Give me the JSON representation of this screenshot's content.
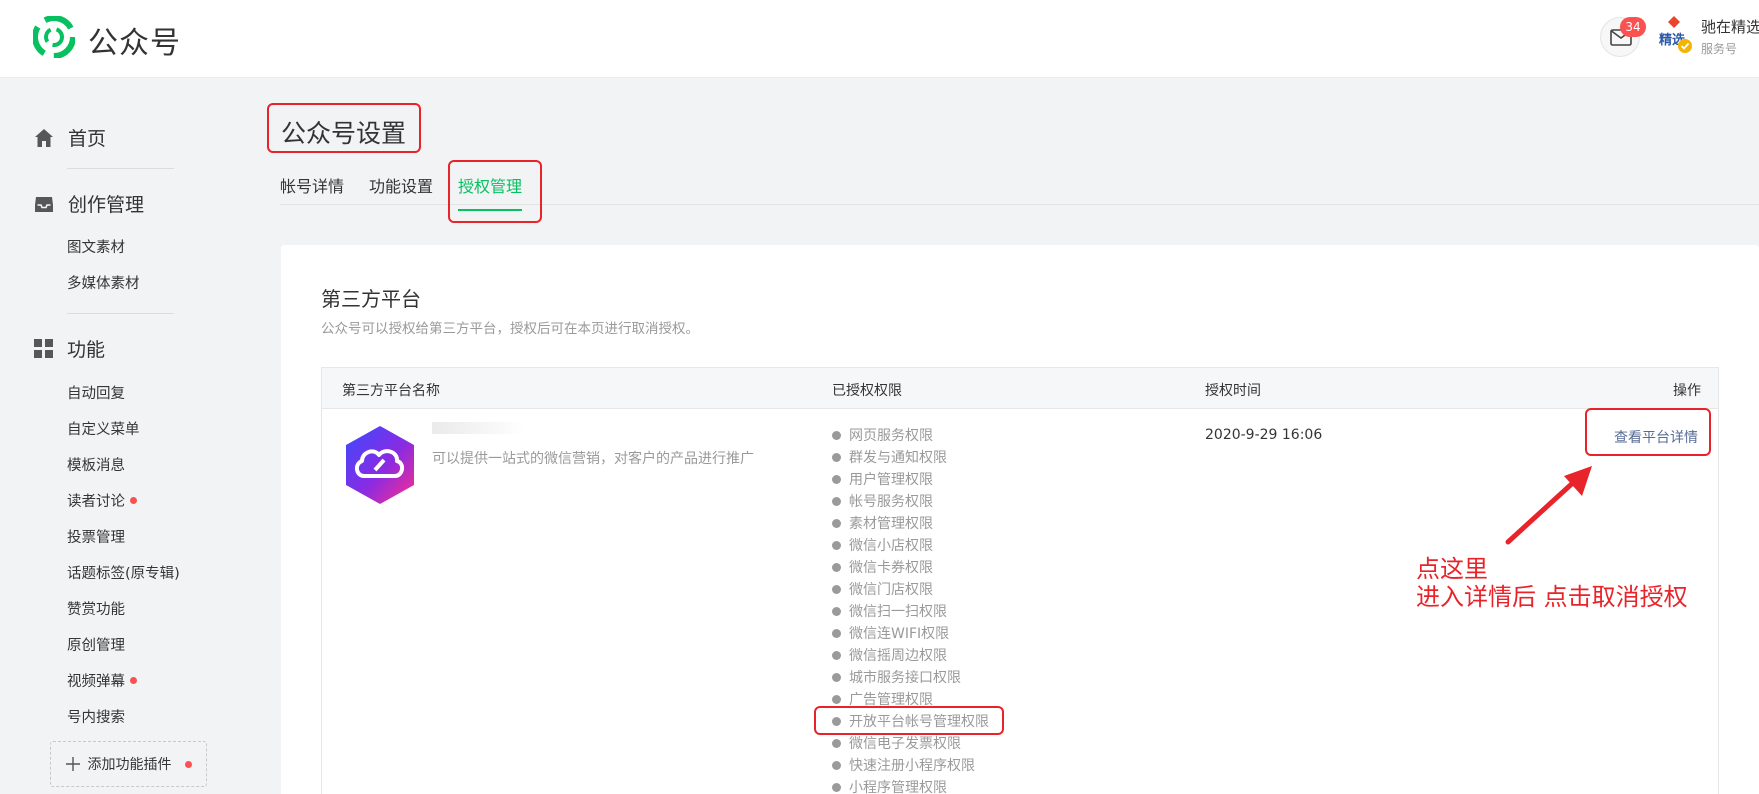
{
  "header": {
    "brand": "公众号",
    "unread_count": "34",
    "account_name": "驰在精选",
    "account_type": "服务号",
    "colors": {
      "brand_green": "#07c160",
      "badge_red": "#fa5151"
    }
  },
  "sidebar": {
    "home": "首页",
    "creation": {
      "label": "创作管理",
      "items": [
        "图文素材",
        "多媒体素材"
      ]
    },
    "features": {
      "label": "功能",
      "items": [
        {
          "label": "自动回复",
          "dot": false
        },
        {
          "label": "自定义菜单",
          "dot": false
        },
        {
          "label": "模板消息",
          "dot": false
        },
        {
          "label": "读者讨论",
          "dot": true
        },
        {
          "label": "投票管理",
          "dot": false
        },
        {
          "label": "话题标签(原专辑)",
          "dot": false
        },
        {
          "label": "赞赏功能",
          "dot": false
        },
        {
          "label": "原创管理",
          "dot": false
        },
        {
          "label": "视频弹幕",
          "dot": true
        },
        {
          "label": "号内搜索",
          "dot": false
        }
      ]
    },
    "add_plugin": "添加功能插件"
  },
  "main": {
    "title": "公众号设置",
    "tabs": [
      {
        "label": "帐号详情",
        "active": false
      },
      {
        "label": "功能设置",
        "active": false
      },
      {
        "label": "授权管理",
        "active": true
      }
    ],
    "section": {
      "title": "第三方平台",
      "desc": "公众号可以授权给第三方平台，授权后可在本页进行取消授权。"
    },
    "table": {
      "headers": [
        "第三方平台名称",
        "已授权权限",
        "授权时间",
        "操作"
      ],
      "row": {
        "desc": "可以提供一站式的微信营销，对客户的产品进行推广",
        "time": "2020-9-29 16:06",
        "action": "查看平台详情",
        "permissions": [
          "网页服务权限",
          "群发与通知权限",
          "用户管理权限",
          "帐号服务权限",
          "素材管理权限",
          "微信小店权限",
          "微信卡券权限",
          "微信门店权限",
          "微信扫一扫权限",
          "微信连WIFI权限",
          "微信摇周边权限",
          "城市服务接口权限",
          "广告管理权限",
          "开放平台帐号管理权限",
          "微信电子发票权限",
          "快速注册小程序权限",
          "小程序管理权限"
        ]
      }
    }
  },
  "annotation": {
    "line1": "点这里",
    "line2": "进入详情后 点击取消授权",
    "color": "#e8232a"
  }
}
